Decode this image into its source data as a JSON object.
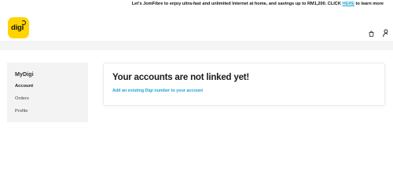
{
  "promo": {
    "text_before": "Let's JomFibre to enjoy ultra-fast and unlimited Internet at home, and savings up to RM1,200. CLICK ",
    "link_text": "HERE",
    "text_after": " to learn more"
  },
  "header": {
    "logo_text": "digi",
    "icons": [
      "cart-icon",
      "user-icon"
    ]
  },
  "sidebar": {
    "title": "MyDigi",
    "items": [
      {
        "label": "Account",
        "active": true
      },
      {
        "label": "Orders",
        "active": false
      },
      {
        "label": "Profile",
        "active": false
      }
    ]
  },
  "main": {
    "heading": "Your accounts are not linked yet!",
    "link_label": "Add an existing Digi number to your account"
  },
  "colors": {
    "brand_yellow": "#ffd400",
    "link_blue": "#1aa3d8",
    "sidebar_bg": "#f3f3f3"
  }
}
